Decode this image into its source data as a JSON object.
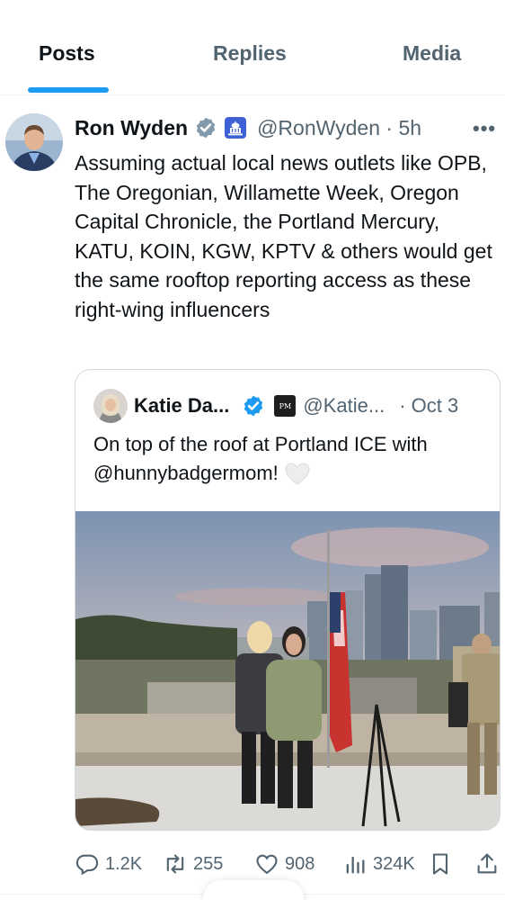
{
  "tabs": [
    {
      "label": "Posts",
      "active": true
    },
    {
      "label": "Replies",
      "active": false
    },
    {
      "label": "Media",
      "active": false
    }
  ],
  "post": {
    "author_name": "Ron Wyden",
    "handle_time": "@RonWyden · 5h",
    "text": "Assuming actual local news outlets like OPB, The Oregonian, Willamette Week, Oregon Capital Chronicle, the Portland Mercury, KATU, KOIN, KGW, KPTV & others would get the same rooftop reporting access as these right-wing influencers",
    "verified_icon": "verified-badge-icon",
    "affiliation_icon": "us-government-capitol-icon"
  },
  "quote": {
    "author_name": "Katie Da...",
    "badge_text": "PM",
    "handle": "@Katie...",
    "date": "· Oct 3",
    "text": "On top of the roof at Portland ICE with @hunnybadgermom!",
    "emoji_icon": "white-heart-icon",
    "photo": "rooftop-photo-two-women-flag-city-skyline"
  },
  "actions": {
    "replies": "1.2K",
    "reposts": "255",
    "likes": "908",
    "views": "324K"
  },
  "colors": {
    "accent": "#1d9bf0",
    "text": "#0f1419",
    "muted": "#536471",
    "border": "#cfd9de"
  }
}
